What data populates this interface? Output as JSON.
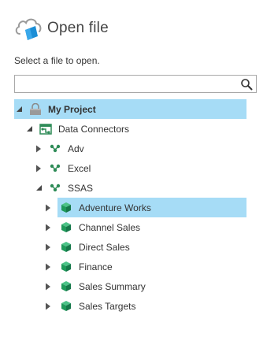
{
  "header": {
    "title": "Open file",
    "icon": "cloud-open-icon"
  },
  "subtitle": "Select a file to open.",
  "search": {
    "value": "",
    "icon": "search-icon"
  },
  "colors": {
    "selection": "#a6dcf6",
    "cube": "#1f9a5a",
    "connector": "#2e8b57"
  },
  "tree": {
    "project": {
      "label": "My Project",
      "expanded": true,
      "selected": true,
      "icon": "project-icon"
    },
    "data_connectors": {
      "label": "Data Connectors",
      "expanded": true,
      "icon": "data-connectors-icon"
    },
    "connectors": [
      {
        "label": "Adv",
        "expanded": false,
        "icon": "connector-icon"
      },
      {
        "label": "Excel",
        "expanded": false,
        "icon": "connector-icon"
      },
      {
        "label": "SSAS",
        "expanded": true,
        "icon": "connector-icon"
      }
    ],
    "cubes": [
      {
        "label": "Adventure Works",
        "selected": true,
        "icon": "cube-icon"
      },
      {
        "label": "Channel Sales",
        "selected": false,
        "icon": "cube-icon"
      },
      {
        "label": "Direct Sales",
        "selected": false,
        "icon": "cube-icon"
      },
      {
        "label": "Finance",
        "selected": false,
        "icon": "cube-icon"
      },
      {
        "label": "Sales Summary",
        "selected": false,
        "icon": "cube-icon"
      },
      {
        "label": "Sales Targets",
        "selected": false,
        "icon": "cube-icon"
      }
    ]
  }
}
